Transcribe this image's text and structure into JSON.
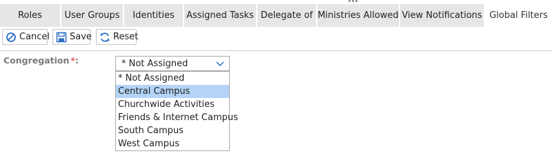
{
  "tabs": [
    {
      "label": "Roles"
    },
    {
      "label": "User Groups"
    },
    {
      "label": "Identities"
    },
    {
      "label": "Assigned Tasks"
    },
    {
      "label": "Delegate of"
    },
    {
      "label": "Ministries Allowed"
    },
    {
      "label": "View Notifications"
    },
    {
      "label": "Global Filters",
      "active": true
    }
  ],
  "toolbar": {
    "cancel_label": "Cancel",
    "save_label": "Save",
    "reset_label": "Reset"
  },
  "form": {
    "congregation_label": "Congregation",
    "required_marker": "*",
    "colon": ":",
    "selected_value": "* Not Assigned",
    "options": [
      {
        "label": "* Not Assigned"
      },
      {
        "label": "Central Campus",
        "highlighted": true
      },
      {
        "label": "Churchwide Activities"
      },
      {
        "label": "Friends & Internet Campus"
      },
      {
        "label": "South Campus"
      },
      {
        "label": "West Campus"
      }
    ]
  },
  "colors": {
    "tab_inactive": "#e6e6e6",
    "highlight": "#b4d4f7",
    "required": "#e05a5a",
    "icon_blue": "#2a6fc2"
  }
}
